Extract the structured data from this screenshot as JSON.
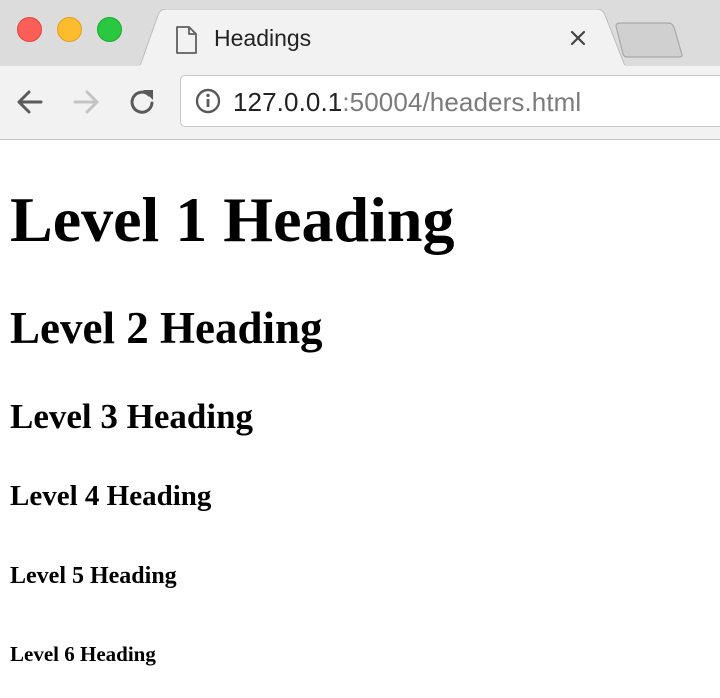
{
  "browser": {
    "tab": {
      "title": "Headings",
      "favicon": "document-icon"
    },
    "address_bar": {
      "host": "127.0.0.1",
      "rest": ":50004/headers.html"
    },
    "icons": {
      "back": "arrow-left-icon",
      "forward": "arrow-right-icon",
      "reload": "reload-icon",
      "site_info": "info-icon",
      "tab_close": "close-icon"
    },
    "colors": {
      "close_light": "#fc5f57",
      "minimize_light": "#fdbc2e",
      "zoom_light": "#29c840",
      "tabstrip": "#dcdcdc",
      "toolbar": "#f2f2f2"
    }
  },
  "page": {
    "h1": "Level 1 Heading",
    "h2": "Level 2 Heading",
    "h3": "Level 3 Heading",
    "h4": "Level 4 Heading",
    "h5": "Level 5 Heading",
    "h6": "Level 6 Heading"
  }
}
